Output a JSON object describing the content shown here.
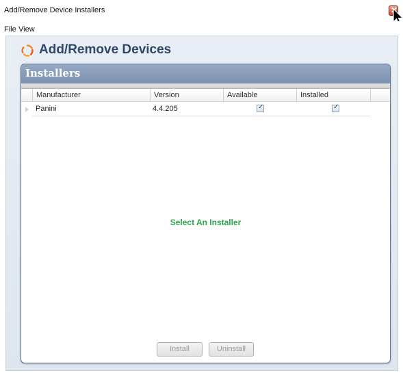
{
  "window": {
    "title": "Add/Remove Device Installers",
    "close_glyph": "✕"
  },
  "menu": {
    "items": [
      {
        "label": "File"
      },
      {
        "label": "View"
      }
    ]
  },
  "header": {
    "icon": "spinner-logo-icon",
    "title": "Add/Remove Devices",
    "title_color": "#2f4666"
  },
  "panel": {
    "title": "Installers",
    "columns": [
      "Manufacturer",
      "Version",
      "Available",
      "Installed"
    ],
    "rows": [
      {
        "manufacturer": "Panini",
        "version": "4.4.205",
        "available": true,
        "installed": true
      }
    ],
    "status": "Select An Installer",
    "status_color": "#2aa54e"
  },
  "buttons": {
    "install": "Install",
    "uninstall": "Uninstall"
  }
}
